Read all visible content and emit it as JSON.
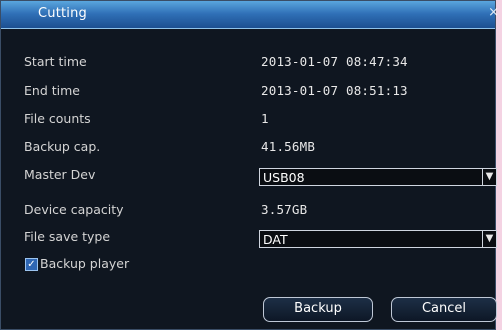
{
  "dialog": {
    "title": "Cutting",
    "close_glyph": "×"
  },
  "rows": {
    "start_time": {
      "label": "Start time",
      "value": "2013-01-07 08:47:34"
    },
    "end_time": {
      "label": "End time",
      "value": "2013-01-07 08:51:13"
    },
    "file_counts": {
      "label": "File counts",
      "value": "1"
    },
    "backup_cap": {
      "label": "Backup cap.",
      "value": "41.56MB"
    },
    "master_dev": {
      "label": "Master Dev",
      "value": "USB08"
    },
    "device_capacity": {
      "label": "Device capacity",
      "value": "3.57GB"
    },
    "file_save_type": {
      "label": "File save type",
      "value": "DAT"
    }
  },
  "backup_player": {
    "label": "Backup player",
    "checked": true
  },
  "buttons": {
    "backup": "Backup",
    "cancel": "Cancel"
  },
  "icons": {
    "dropdown": "chevron-down-icon",
    "checkbox": "check-icon"
  },
  "colors": {
    "background": "#0f1620",
    "title_bar": "#2f6fb6",
    "checkbox": "#2f67b4"
  }
}
